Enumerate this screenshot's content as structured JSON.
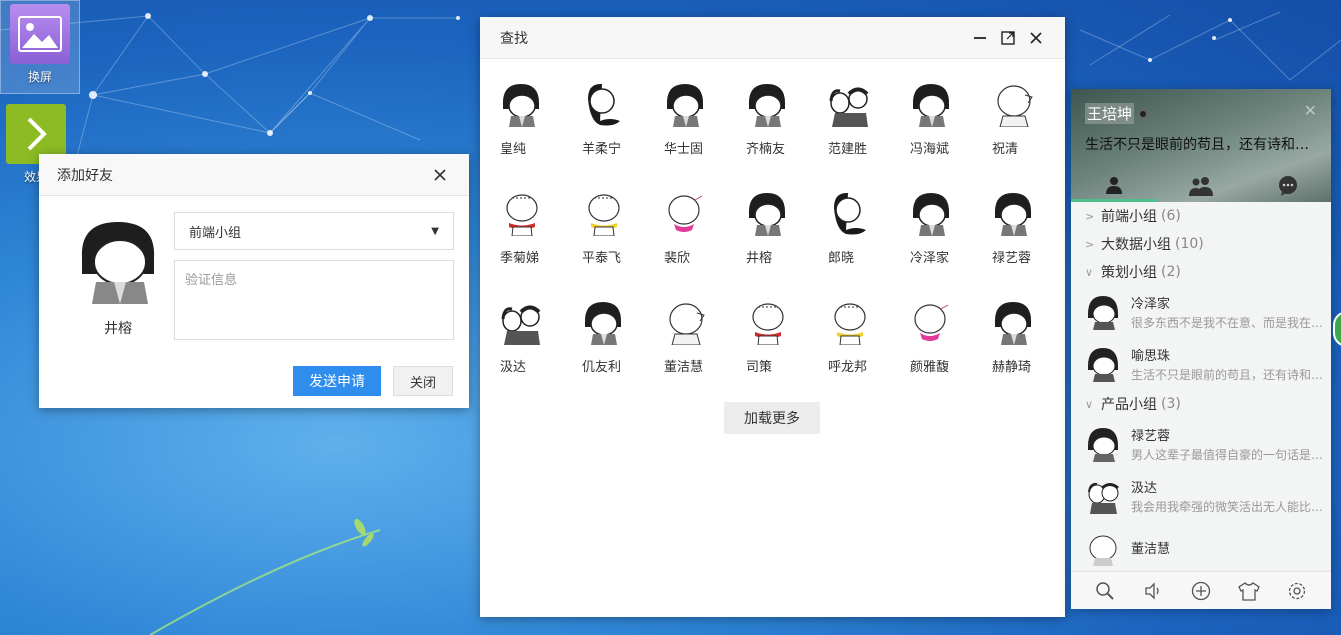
{
  "desktop": {
    "icons": [
      {
        "label": "换屏"
      },
      {
        "label": "效果"
      }
    ]
  },
  "add_friend": {
    "title": "添加好友",
    "user_name": "井榕",
    "group_select": "前端小组",
    "verify_placeholder": "验证信息",
    "send_label": "发送申请",
    "close_label": "关闭"
  },
  "find": {
    "title": "查找",
    "load_more": "加载更多",
    "results": [
      {
        "name": "皇纯",
        "avatar": "hair"
      },
      {
        "name": "羊柔宁",
        "avatar": "long"
      },
      {
        "name": "华士固",
        "avatar": "hair"
      },
      {
        "name": "齐楠友",
        "avatar": "hair"
      },
      {
        "name": "范建胜",
        "avatar": "pair"
      },
      {
        "name": "冯海斌",
        "avatar": "hair"
      },
      {
        "name": "祝清",
        "avatar": "bald"
      },
      {
        "name": "季菊娣",
        "avatar": "bald-red"
      },
      {
        "name": "平泰飞",
        "avatar": "bald-yellow"
      },
      {
        "name": "裴欣",
        "avatar": "bald-pink"
      },
      {
        "name": "井榕",
        "avatar": "hair"
      },
      {
        "name": "郎晓",
        "avatar": "long"
      },
      {
        "name": "冷泽家",
        "avatar": "hair"
      },
      {
        "name": "禄艺蓉",
        "avatar": "hair"
      },
      {
        "name": "汲达",
        "avatar": "pair"
      },
      {
        "name": "仉友利",
        "avatar": "hair"
      },
      {
        "name": "董洁慧",
        "avatar": "bald"
      },
      {
        "name": "司策",
        "avatar": "bald-red"
      },
      {
        "name": "呼龙邦",
        "avatar": "bald-yellow"
      },
      {
        "name": "颜雅馥",
        "avatar": "bald-pink"
      },
      {
        "name": "赫静琦",
        "avatar": "hair"
      }
    ]
  },
  "main_panel": {
    "user_name": "王培坤",
    "signature": "生活不只是眼前的苟且，还有诗和远方的田野",
    "groups": [
      {
        "name": "前端小组",
        "count": "(6)",
        "expanded": false
      },
      {
        "name": "大数据小组",
        "count": "(10)",
        "expanded": false
      },
      {
        "name": "策划小组",
        "count": "(2)",
        "expanded": true
      },
      {
        "name": "产品小组",
        "count": "(3)",
        "expanded": true
      }
    ],
    "friends_plan": [
      {
        "name": "冷泽家",
        "sign": "很多东西不是我不在意、而是我在意了又能怎样"
      },
      {
        "name": "喻思珠",
        "sign": "生活不只是眼前的苟且，还有诗和远方"
      }
    ],
    "friends_product": [
      {
        "name": "禄艺蓉",
        "sign": "男人这辈子最值得自豪的一句话是：我的前任"
      },
      {
        "name": "汲达",
        "sign": "我会用我牵强的微笑活出无人能比的骄傲"
      },
      {
        "name": "董洁慧",
        "sign": ""
      }
    ]
  },
  "colors": {
    "primary": "#2e8ded",
    "accent": "#4fc08d",
    "desktop": "#1b63be"
  }
}
